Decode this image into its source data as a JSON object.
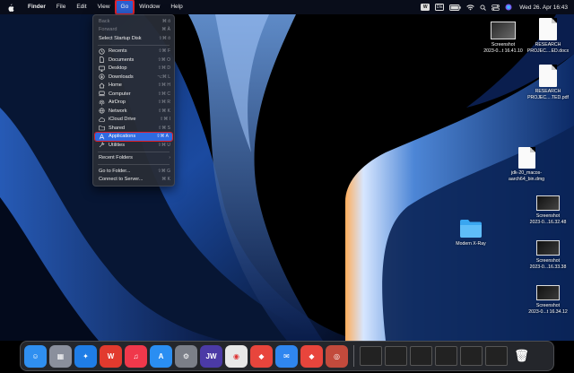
{
  "menubar": {
    "app_name": "Finder",
    "items": [
      "File",
      "Edit",
      "View",
      "Go",
      "Window",
      "Help"
    ],
    "active_item": "Go",
    "status": {
      "keyboard_badge": "W",
      "language": "DE",
      "datetime": "Wed 26. Apr 16:43"
    }
  },
  "go_menu": {
    "items": [
      {
        "label": "Back",
        "shortcut": "⌘ ö",
        "disabled": true,
        "icon": null
      },
      {
        "label": "Forward",
        "shortcut": "⌘ Ä",
        "disabled": true,
        "icon": null
      },
      {
        "label": "Select Startup Disk",
        "shortcut": "⇧⌘ ö",
        "disabled": false,
        "icon": null
      },
      {
        "label": "Recents",
        "shortcut": "⇧⌘ F",
        "icon": "clock-icon"
      },
      {
        "label": "Documents",
        "shortcut": "⇧⌘ O",
        "icon": "document-icon"
      },
      {
        "label": "Desktop",
        "shortcut": "⇧⌘ D",
        "icon": "desktop-icon"
      },
      {
        "label": "Downloads",
        "shortcut": "⌥⌘ L",
        "icon": "download-icon"
      },
      {
        "label": "Home",
        "shortcut": "⇧⌘ H",
        "icon": "home-icon"
      },
      {
        "label": "Computer",
        "shortcut": "⇧⌘ C",
        "icon": "computer-icon"
      },
      {
        "label": "AirDrop",
        "shortcut": "⇧⌘ R",
        "icon": "airdrop-icon"
      },
      {
        "label": "Network",
        "shortcut": "⇧⌘ K",
        "icon": "network-icon"
      },
      {
        "label": "iCloud Drive",
        "shortcut": "⇧⌘ I",
        "icon": "cloud-icon"
      },
      {
        "label": "Shared",
        "shortcut": "⇧⌘ S",
        "icon": "shared-folder-icon"
      },
      {
        "label": "Applications",
        "shortcut": "⇧⌘ A",
        "icon": "applications-icon",
        "highlighted": true
      },
      {
        "label": "Utilities",
        "shortcut": "⇧⌘ U",
        "icon": "utilities-icon"
      },
      {
        "label": "Recent Folders",
        "shortcut": "›",
        "icon": null
      },
      {
        "label": "Go to Folder...",
        "shortcut": "⇧⌘ G",
        "icon": null
      },
      {
        "label": "Connect to Server...",
        "shortcut": "⌘ K",
        "icon": null
      }
    ]
  },
  "desktop_icons": [
    {
      "label1": "Screenshot",
      "label2": "2023-0...t 16.41.10"
    },
    {
      "label1": "RESEARCH",
      "label2": "PROJEC....ED.docx"
    },
    {
      "label1": "RESEARCH",
      "label2": "PROJEC....TED.pdf"
    },
    {
      "label1": "jdk-20_macos-",
      "label2": "aarch64_bin.dmg"
    },
    {
      "label1": "Modern X-Ray",
      "label2": ""
    },
    {
      "label1": "Screenshot",
      "label2": "2023-0...16.32.48"
    },
    {
      "label1": "Screenshot",
      "label2": "2023-0...16.33.38"
    },
    {
      "label1": "Screenshot",
      "label2": "2023-0...t 16.34.12"
    }
  ],
  "dock": {
    "apps": [
      {
        "name": "finder-app",
        "glyph": "☺",
        "color": "#2f8ff0"
      },
      {
        "name": "launchpad-app",
        "glyph": "▦",
        "color": "#8a8f9c"
      },
      {
        "name": "safari-app",
        "glyph": "✦",
        "color": "#1f7de6"
      },
      {
        "name": "wps-app",
        "glyph": "W",
        "color": "#e23a2e"
      },
      {
        "name": "music-app",
        "glyph": "♫",
        "color": "#f0384b"
      },
      {
        "name": "app-store-app",
        "glyph": "A",
        "color": "#2a8ef2"
      },
      {
        "name": "system-settings-app",
        "glyph": "⚙",
        "color": "#7b7f88"
      },
      {
        "name": "jw-library-app",
        "glyph": "JW",
        "color": "#4b3aa6"
      },
      {
        "name": "chrome-app",
        "glyph": "◉",
        "color": "#e8e8e8"
      },
      {
        "name": "anydesk-app",
        "glyph": "◆",
        "color": "#e8453c"
      },
      {
        "name": "mail-app",
        "glyph": "✉",
        "color": "#2f86ef"
      },
      {
        "name": "anydesk2-app",
        "glyph": "◆",
        "color": "#e8453c"
      },
      {
        "name": "instruments-app",
        "glyph": "◎",
        "color": "#c24a3c"
      }
    ],
    "trash_glyph": "🗑"
  }
}
